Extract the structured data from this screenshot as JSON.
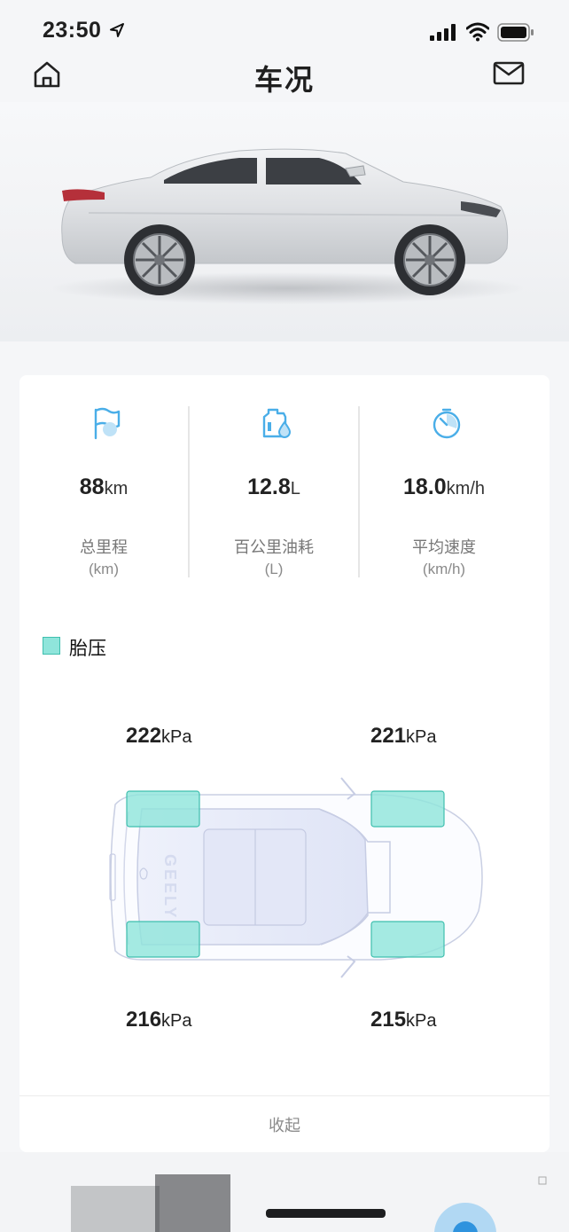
{
  "status_bar": {
    "time": "23:50"
  },
  "nav": {
    "title": "车况"
  },
  "stats": [
    {
      "value": "88",
      "unit": "km",
      "label": "总里程",
      "sub": "(km)",
      "icon": "flag-icon"
    },
    {
      "value": "12.8",
      "unit": "L",
      "label": "百公里油耗",
      "sub": "(L)",
      "icon": "fuel-icon"
    },
    {
      "value": "18.0",
      "unit": "km/h",
      "label": "平均速度",
      "sub": "(km/h)",
      "icon": "speed-icon"
    }
  ],
  "tire_pressure": {
    "legend": "胎压",
    "front_left": {
      "value": "222",
      "unit": "kPa"
    },
    "front_right": {
      "value": "221",
      "unit": "kPa"
    },
    "rear_left": {
      "value": "216",
      "unit": "kPa"
    },
    "rear_right": {
      "value": "215",
      "unit": "kPa"
    },
    "car_logo": "GEELY"
  },
  "collapse_label": "收起",
  "colors": {
    "accent": "#4aaee8",
    "tire_fill": "#8fe5db",
    "tire_border": "#3fbfae"
  }
}
